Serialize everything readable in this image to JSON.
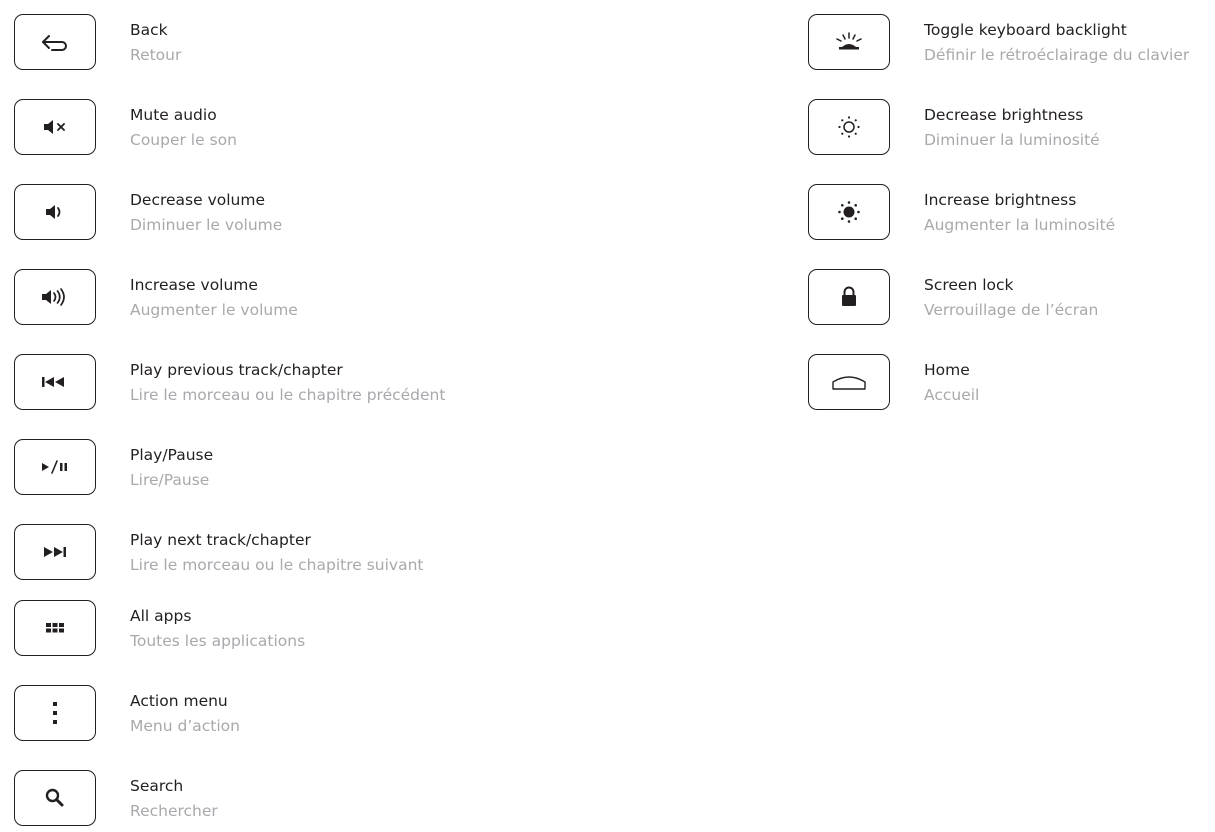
{
  "left_column": [
    {
      "id": "back",
      "icon": "back-arrow-icon",
      "en": "Back",
      "fr": "Retour"
    },
    {
      "id": "mute",
      "icon": "speaker-mute-icon",
      "en": "Mute audio",
      "fr": "Couper le son"
    },
    {
      "id": "vol-down",
      "icon": "speaker-low-icon",
      "en": "Decrease volume",
      "fr": "Diminuer le volume"
    },
    {
      "id": "vol-up",
      "icon": "speaker-high-icon",
      "en": "Increase volume",
      "fr": "Augmenter le volume"
    },
    {
      "id": "prev",
      "icon": "previous-track-icon",
      "en": "Play previous track/chapter",
      "fr": "Lire le morceau ou le chapitre précédent"
    },
    {
      "id": "playpause",
      "icon": "play-pause-icon",
      "en": "Play/Pause",
      "fr": "Lire/Pause"
    },
    {
      "id": "next",
      "icon": "next-track-icon",
      "en": "Play next track/chapter",
      "fr": "Lire le morceau ou le chapitre suivant"
    },
    {
      "id": "apps",
      "icon": "app-grid-icon",
      "en": "All apps",
      "fr": "Toutes les applications"
    },
    {
      "id": "menu",
      "icon": "vertical-dots-icon",
      "en": "Action menu",
      "fr": "Menu d’action"
    },
    {
      "id": "search",
      "icon": "magnifier-icon",
      "en": "Search",
      "fr": "Rechercher"
    }
  ],
  "right_column": [
    {
      "id": "backlight",
      "icon": "keyboard-backlight-icon",
      "en": "Toggle keyboard backlight",
      "fr": "Définir le rétroéclairage du clavier"
    },
    {
      "id": "bright-down",
      "icon": "sun-outline-icon",
      "en": "Decrease brightness",
      "fr": "Diminuer la luminosité"
    },
    {
      "id": "bright-up",
      "icon": "sun-filled-icon",
      "en": "Increase brightness",
      "fr": "Augmenter la luminosité"
    },
    {
      "id": "lock",
      "icon": "padlock-icon",
      "en": "Screen lock",
      "fr": "Verrouillage de l’écran"
    },
    {
      "id": "home",
      "icon": "home-outline-icon",
      "en": "Home",
      "fr": "Accueil"
    }
  ],
  "colors": {
    "primary_text": "#231f20",
    "secondary_text": "#a7a9ac",
    "key_border": "#231f20"
  }
}
